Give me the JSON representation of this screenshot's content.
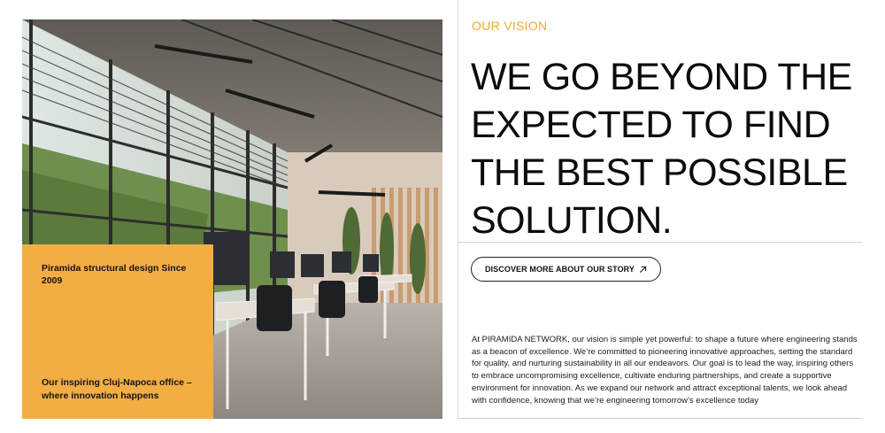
{
  "photo": {
    "alt": "Office interior"
  },
  "caption": {
    "top": "Piramida structural design Since 2009",
    "bottom": "Our inspiring Cluj-Napoca office – where innovation happens"
  },
  "vision": {
    "eyebrow": "OUR VISION",
    "headline_lines": [
      "WE GO BEYOND THE",
      "EXPECTED TO FIND",
      "THE BEST POSSIBLE",
      "SOLUTION."
    ],
    "button_label": "DISCOVER MORE ABOUT OUR STORY",
    "button_icon": "arrow-up-right-icon",
    "body": "At PIRAMIDA NETWORK, our vision is simple yet powerful: to shape a future where engineering stands as a beacon of excellence. We’re committed to pioneering innovative approaches, setting the standard for quality, and nurturing sustainability in all our endeavors. Our goal is to lead the way, inspiring others to embrace uncompromising excellence, cultivate enduring partnerships, and create a supportive environment for innovation. As we expand our network and attract exceptional talents, we look ahead with confidence, knowing that we’re engineering tomorrow’s excellence today"
  },
  "colors": {
    "accent": "#f2ad45",
    "eyebrow": "#f0a830",
    "text": "#0c0c0c"
  }
}
